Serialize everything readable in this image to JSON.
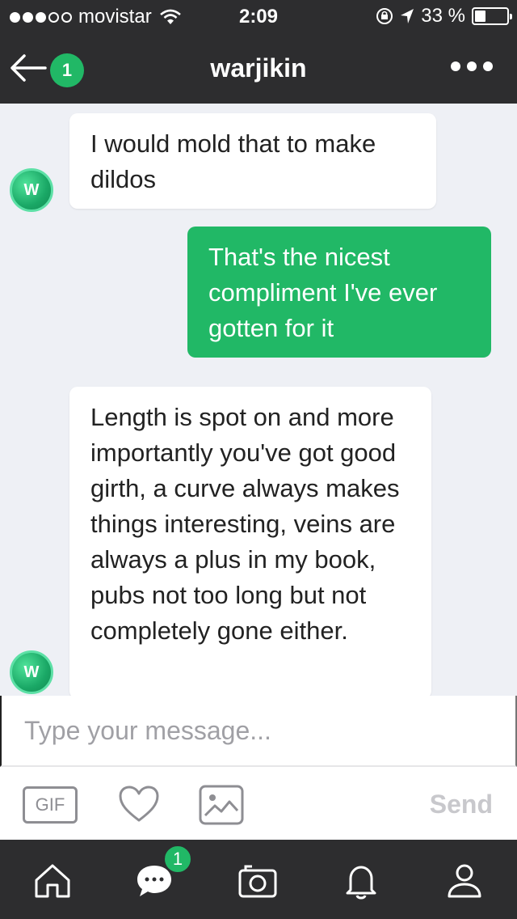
{
  "status_bar": {
    "carrier": "movistar",
    "time": "2:09",
    "battery_percent": "33 %",
    "battery_level": 0.33
  },
  "header": {
    "title": "warjikin",
    "back_badge": "1"
  },
  "messages": [
    {
      "direction": "in",
      "text": "I would mold that to make dildos",
      "avatar_letter": "W"
    },
    {
      "direction": "out",
      "text": "That's the nicest compliment I've ever gotten for it"
    },
    {
      "direction": "in",
      "text": "Length is spot on and more importantly you've got good girth, a curve always makes things interesting, veins are always a plus in my book, pubs not too long but not completely gone either.",
      "avatar_letter": "W"
    }
  ],
  "composer": {
    "placeholder": "Type your message...",
    "gif_label": "GIF",
    "send_label": "Send"
  },
  "tab_bar": {
    "chat_badge": "1"
  },
  "colors": {
    "accent": "#21b866",
    "dark_bar": "#2d2d2f",
    "chat_bg": "#eef0f5"
  }
}
